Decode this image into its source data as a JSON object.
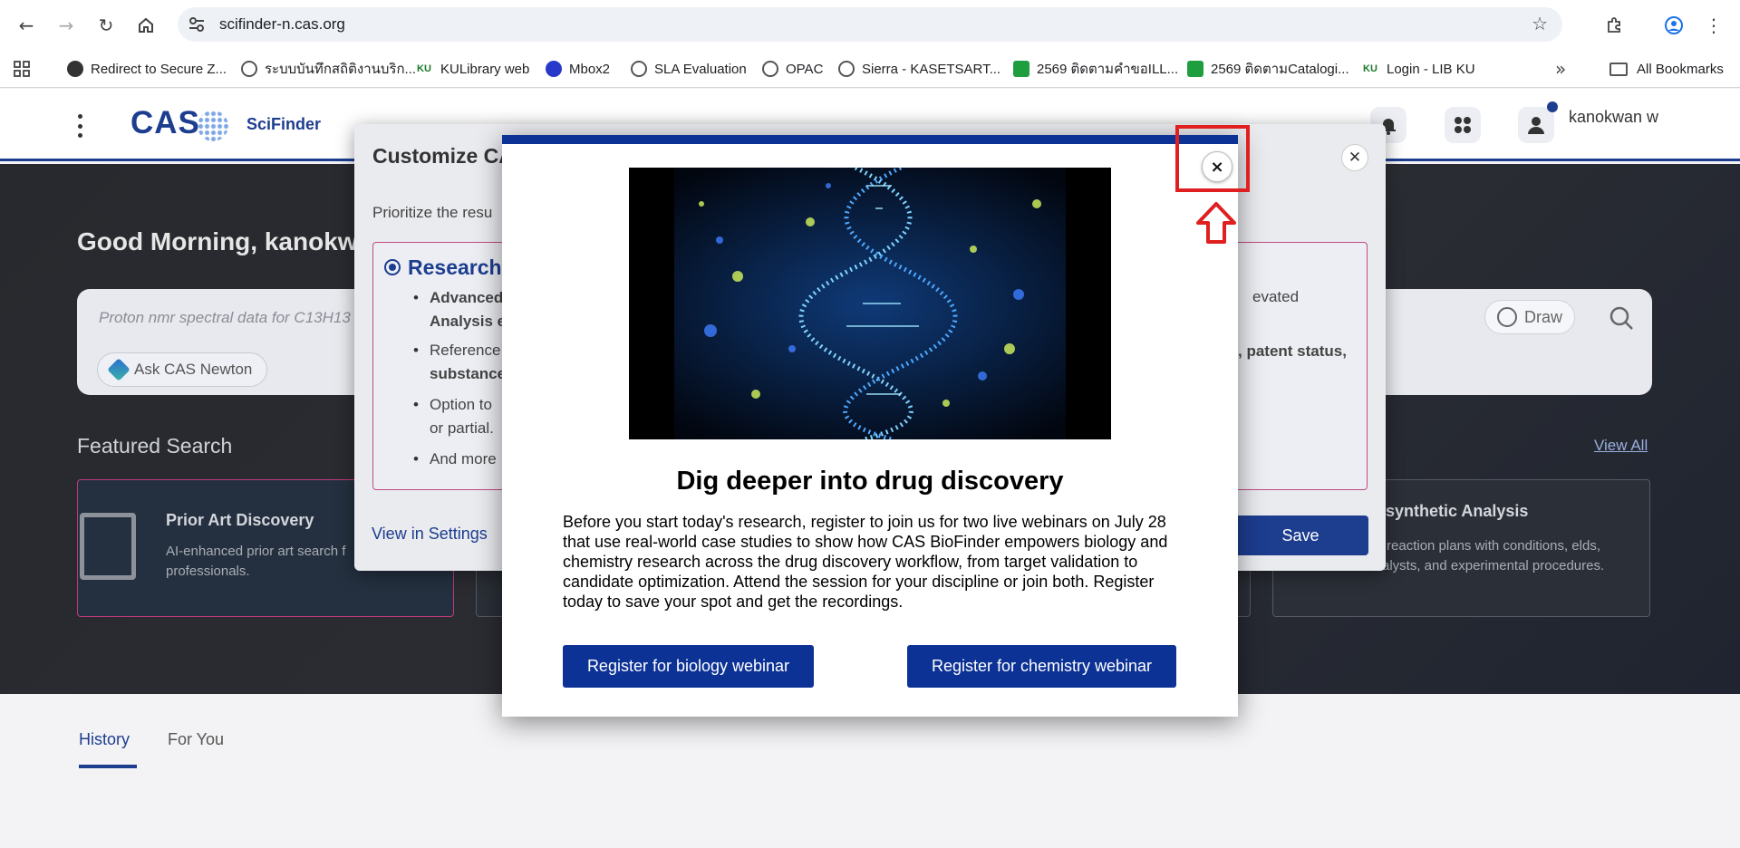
{
  "browser": {
    "url": "scifinder-n.cas.org",
    "bookmarks": [
      {
        "label": "Redirect to Secure Z...",
        "icon": "dark-circle-icon"
      },
      {
        "label": "ระบบบันทึกสถิติงานบริก...",
        "icon": "globe-icon"
      },
      {
        "label": "KULibrary web",
        "icon": "ku-icon"
      },
      {
        "label": "Mbox2",
        "icon": "mbox-icon"
      },
      {
        "label": "SLA Evaluation",
        "icon": "globe-icon"
      },
      {
        "label": "OPAC",
        "icon": "globe-icon"
      },
      {
        "label": "Sierra - KASETSART...",
        "icon": "globe-icon"
      },
      {
        "label": "2569 ติดตามคำขอILL...",
        "icon": "sheets-icon"
      },
      {
        "label": "2569 ติดตามCatalogi...",
        "icon": "sheets-icon"
      },
      {
        "label": "Login - LIB KU",
        "icon": "ku-icon"
      }
    ],
    "all_bookmarks_label": "All Bookmarks"
  },
  "app": {
    "logo_text": "CAS",
    "product_name": "SciFinder",
    "user_name": "kanokwan w",
    "greeting": "Good Morning, kanokw",
    "search_placeholder": "Proton nmr spectral data for C13H13",
    "draw_label": "Draw",
    "newton_label": "Ask CAS Newton",
    "featured_heading": "Featured Search",
    "view_all": "View All",
    "featured_cards": [
      {
        "title": "Prior Art Discovery",
        "desc": "AI-enhanced prior art search f professionals."
      },
      {
        "title": "trosynthetic Analysis",
        "desc": "ate reaction plans with conditions, elds, catalysts, and experimental procedures."
      }
    ],
    "tabs": [
      "History",
      "For You"
    ]
  },
  "customize_dialog": {
    "title": "Customize CA",
    "subtitle": "Prioritize the resu",
    "option_title": "Research",
    "bullets": [
      {
        "bold": "Advanced",
        "rest": "",
        "line2_bold": "Analysis e",
        "line2": ""
      },
      {
        "bold": "",
        "rest": "Reference",
        "line2_bold": "substance",
        "line2": ""
      },
      {
        "bold": "",
        "rest": "Option to",
        "line2_bold": "",
        "line2": "or partial."
      },
      {
        "bold": "",
        "rest": "And more",
        "line2_bold": "",
        "line2": ""
      }
    ],
    "right_text_1": "evated",
    "right_text_2": ", patent status,",
    "view_settings": "View in Settings",
    "save_label": "Save"
  },
  "promo": {
    "title": "Dig deeper into drug discovery",
    "body": "Before you start today's research, register to join us for two live webinars on July 28 that use real-world case studies to show how CAS BioFinder empowers biology and chemistry research across the drug discovery workflow, from target validation to candidate optimization. Attend the session for your discipline or join both. Register today to save your spot and get the recordings.",
    "btn_bio": "Register for biology webinar",
    "btn_chem": "Register for chemistry webinar",
    "close_symbol": "×",
    "image_icon": "dna-helix-image"
  },
  "colors": {
    "brand_blue": "#1d3d8f",
    "promo_blue": "#0d3296",
    "annotation_red": "#e02020"
  }
}
